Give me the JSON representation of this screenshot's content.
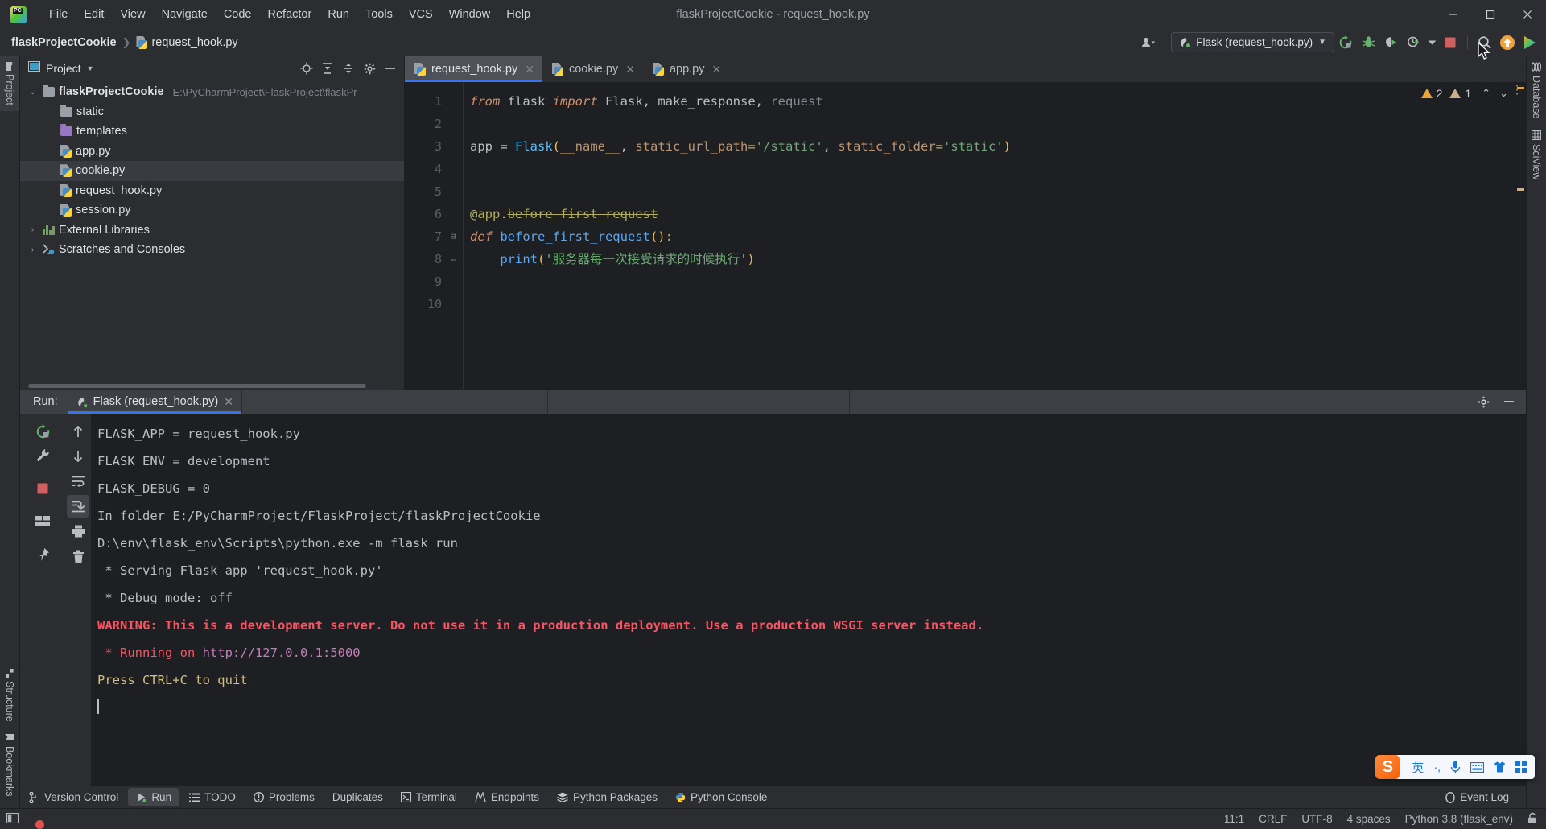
{
  "window": {
    "title": "flaskProjectCookie - request_hook.py",
    "minimize": "–",
    "maximize": "▢",
    "close": "✕"
  },
  "menu": [
    {
      "label": "File"
    },
    {
      "label": "Edit"
    },
    {
      "label": "View"
    },
    {
      "label": "Navigate"
    },
    {
      "label": "Code"
    },
    {
      "label": "Refactor"
    },
    {
      "label": "Run"
    },
    {
      "label": "Tools"
    },
    {
      "label": "VCS"
    },
    {
      "label": "Window"
    },
    {
      "label": "Help"
    }
  ],
  "breadcrumb": {
    "project": "flaskProjectCookie",
    "separator": "❯",
    "file": "request_hook.py"
  },
  "toolbar": {
    "account_icon": "user-account-icon",
    "run_config": "Flask (request_hook.py)",
    "run_config_caret": "▼",
    "icons": [
      "rerun-icon",
      "debug-icon",
      "run-coverage-icon",
      "profiler-icon",
      "more-caret-icon",
      "stop-icon",
      "search-icon",
      "updates-icon",
      "ide-assistant-icon"
    ]
  },
  "left_stripe": [
    {
      "label": "Project",
      "selected": true
    },
    {
      "label": "Structure",
      "selected": false
    },
    {
      "label": "Bookmarks",
      "selected": false
    }
  ],
  "right_stripe": [
    {
      "label": "Database"
    },
    {
      "label": "SciView"
    }
  ],
  "project_panel": {
    "title": "Project",
    "title_caret": "▼",
    "actions": [
      "locate-icon",
      "expand-all-icon",
      "collapse-all-icon",
      "settings-gear-icon",
      "hide-icon"
    ],
    "tree": [
      {
        "indent": 0,
        "arrow": "⌄",
        "icon": "folder",
        "label": "flaskProjectCookie",
        "bold": true,
        "path": "E:\\PyCharmProject\\FlaskProject\\flaskPr",
        "selected": false
      },
      {
        "indent": 1,
        "arrow": "",
        "icon": "folder",
        "label": "static",
        "bold": false,
        "path": "",
        "selected": false
      },
      {
        "indent": 1,
        "arrow": "",
        "icon": "folder-purple",
        "label": "templates",
        "bold": false,
        "path": "",
        "selected": false
      },
      {
        "indent": 1,
        "arrow": "",
        "icon": "python",
        "label": "app.py",
        "bold": false,
        "path": "",
        "selected": false
      },
      {
        "indent": 1,
        "arrow": "",
        "icon": "python",
        "label": "cookie.py",
        "bold": false,
        "path": "",
        "selected": true
      },
      {
        "indent": 1,
        "arrow": "",
        "icon": "python",
        "label": "request_hook.py",
        "bold": false,
        "path": "",
        "selected": false
      },
      {
        "indent": 1,
        "arrow": "",
        "icon": "python",
        "label": "session.py",
        "bold": false,
        "path": "",
        "selected": false
      },
      {
        "indent": 0,
        "arrow": "›",
        "icon": "library",
        "label": "External Libraries",
        "bold": false,
        "path": "",
        "selected": false
      },
      {
        "indent": 0,
        "arrow": "›",
        "icon": "scratch",
        "label": "Scratches and Consoles",
        "bold": false,
        "path": "",
        "selected": false
      }
    ]
  },
  "editor": {
    "tabs": [
      {
        "label": "request_hook.py",
        "active": true,
        "close": "✕"
      },
      {
        "label": "cookie.py",
        "active": false,
        "close": "✕"
      },
      {
        "label": "app.py",
        "active": false,
        "close": "✕"
      }
    ],
    "inspections": {
      "warn_count": "2",
      "weak_warn_count": "1",
      "up": "⌃",
      "down": "⌄",
      "kebab": "⋮"
    },
    "line_numbers": [
      "1",
      "2",
      "3",
      "4",
      "5",
      "6",
      "7",
      "8",
      "9",
      "10"
    ],
    "code_lines": [
      [
        {
          "t": "from ",
          "c": "kw"
        },
        {
          "t": "flask ",
          "c": "id"
        },
        {
          "t": "import ",
          "c": "kw"
        },
        {
          "t": "Flask",
          "c": "id"
        },
        {
          "t": ", ",
          "c": "op"
        },
        {
          "t": "make_response",
          "c": "id"
        },
        {
          "t": ", ",
          "c": "op"
        },
        {
          "t": "request",
          "c": "dim"
        }
      ],
      [],
      [
        {
          "t": "app ",
          "c": "id"
        },
        {
          "t": "= ",
          "c": "op"
        },
        {
          "t": "Flask",
          "c": "cls"
        },
        {
          "t": "(",
          "c": "punct-y"
        },
        {
          "t": "__name__",
          "c": "param"
        },
        {
          "t": ", ",
          "c": "op"
        },
        {
          "t": "static_url_path",
          "c": "param"
        },
        {
          "t": "=",
          "c": "dec"
        },
        {
          "t": "'/static'",
          "c": "str"
        },
        {
          "t": ", ",
          "c": "op"
        },
        {
          "t": "static_folder",
          "c": "param"
        },
        {
          "t": "=",
          "c": "dec"
        },
        {
          "t": "'static'",
          "c": "str"
        },
        {
          "t": ")",
          "c": "punct-y"
        }
      ],
      [],
      [],
      [
        {
          "t": "@app.",
          "c": "dec"
        },
        {
          "t": "before_first_request",
          "c": "deprecated"
        }
      ],
      [
        {
          "t": "def ",
          "c": "kw"
        },
        {
          "t": "before_first_request",
          "c": "fn"
        },
        {
          "t": "()",
          "c": "punct-y"
        },
        {
          "t": ":",
          "c": "dec"
        }
      ],
      [
        {
          "t": "    ",
          "c": "op"
        },
        {
          "t": "print",
          "c": "fn2"
        },
        {
          "t": "(",
          "c": "punct-y"
        },
        {
          "t": "'服务器每一次接受请求的时候执行'",
          "c": "str"
        },
        {
          "t": ")",
          "c": "punct-y"
        }
      ],
      [],
      []
    ]
  },
  "run_panel": {
    "label": "Run:",
    "tab": "Flask (request_hook.py)",
    "tab_close": "✕",
    "actions": [
      "settings-gear-icon",
      "hide-icon"
    ],
    "left_icons": [
      "rerun-icon",
      "wrench-icon",
      "stop-icon",
      "layout-icon",
      "pin-icon"
    ],
    "left_icons2": [
      "scroll-up-icon",
      "scroll-down-icon",
      "soft-wrap-icon",
      "scroll-to-end-icon",
      "print-icon",
      "clear-all-icon"
    ],
    "console": [
      {
        "text": "FLASK_APP = request_hook.py",
        "style": "plain"
      },
      {
        "text": "FLASK_ENV = development",
        "style": "plain"
      },
      {
        "text": "FLASK_DEBUG = 0",
        "style": "plain"
      },
      {
        "text": "In folder E:/PyCharmProject/FlaskProject/flaskProjectCookie",
        "style": "plain"
      },
      {
        "text": "D:\\env\\flask_env\\Scripts\\python.exe -m flask run",
        "style": "plain"
      },
      {
        "text": " * Serving Flask app 'request_hook.py'",
        "style": "plain"
      },
      {
        "text": " * Debug mode: off",
        "style": "plain"
      },
      {
        "text": "WARNING: This is a development server. Do not use it in a production deployment. Use a production WSGI server instead.",
        "style": "warn"
      },
      {
        "text": " * Running on ",
        "style": "run",
        "link": "http://127.0.0.1:5000"
      },
      {
        "text": "Press CTRL+C to quit",
        "style": "press"
      },
      {
        "text": "",
        "style": "caret"
      }
    ]
  },
  "bottom_bar": {
    "items": [
      {
        "label": "Version Control",
        "icon": "branch-icon",
        "selected": false
      },
      {
        "label": "Run",
        "icon": "run-icon",
        "selected": true
      },
      {
        "label": "TODO",
        "icon": "todo-icon",
        "selected": false
      },
      {
        "label": "Problems",
        "icon": "problems-icon",
        "selected": false
      },
      {
        "label": "Duplicates",
        "icon": "duplicates-icon",
        "selected": false
      },
      {
        "label": "Terminal",
        "icon": "terminal-icon",
        "selected": false
      },
      {
        "label": "Endpoints",
        "icon": "endpoints-icon",
        "selected": false
      },
      {
        "label": "Python Packages",
        "icon": "packages-icon",
        "selected": false
      },
      {
        "label": "Python Console",
        "icon": "python-console-icon",
        "selected": false
      }
    ],
    "event_log": "Event Log",
    "event_log_icon": "event-log-icon"
  },
  "status_bar": {
    "left_icon": "hide-tool-windows-icon",
    "caret": "11:1",
    "line_sep": "CRLF",
    "encoding": "UTF-8",
    "indent": "4 spaces",
    "interpreter": "Python 3.8 (flask_env)",
    "lock_icon": "unlocked-icon"
  },
  "ime": {
    "logo": "S",
    "mode": "英",
    "items": [
      "punctuation-icon",
      "voice-input-icon",
      "soft-keyboard-icon",
      "skin-icon",
      "toolbox-icon"
    ],
    "punct": "·,"
  },
  "colors": {
    "accent": "#3574f0",
    "bg": "#2b2d30",
    "editor_bg": "#1e1f22",
    "warn": "#f75464",
    "string": "#6aab73",
    "keyword": "#cf8e6d",
    "selection": "#393b40"
  }
}
